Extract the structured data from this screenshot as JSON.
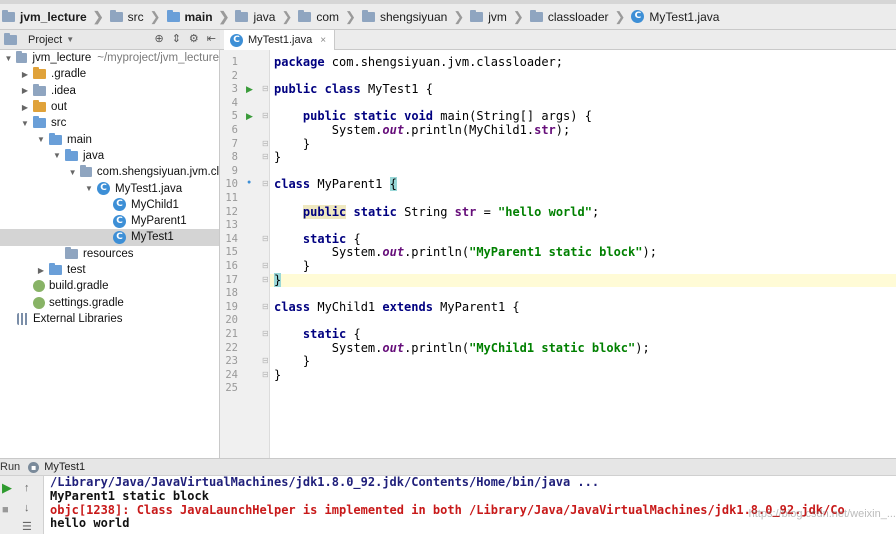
{
  "breadcrumb": [
    {
      "label": "jvm_lecture",
      "icon": "folder-icon",
      "bold": true
    },
    {
      "label": "src",
      "icon": "folder-icon",
      "bold": false
    },
    {
      "label": "main",
      "icon": "folder-icon",
      "bold": true
    },
    {
      "label": "java",
      "icon": "folder-icon",
      "bold": false
    },
    {
      "label": "com",
      "icon": "folder-icon",
      "bold": false
    },
    {
      "label": "shengsiyuan",
      "icon": "folder-icon",
      "bold": false
    },
    {
      "label": "jvm",
      "icon": "folder-icon",
      "bold": false
    },
    {
      "label": "classloader",
      "icon": "folder-icon",
      "bold": false
    },
    {
      "label": "MyTest1.java",
      "icon": "class-icon",
      "bold": false
    }
  ],
  "project": {
    "title": "Project",
    "tree": [
      {
        "label": "jvm_lecture",
        "note": "~/myproject/jvm_lecture",
        "indent": 0,
        "arrow": "down",
        "icon": "folder-icon"
      },
      {
        "label": ".gradle",
        "indent": 1,
        "arrow": "right",
        "icon": "folder-icon"
      },
      {
        "label": ".idea",
        "indent": 1,
        "arrow": "right",
        "icon": "folder-icon"
      },
      {
        "label": "out",
        "indent": 1,
        "arrow": "right",
        "icon": "folder-icon"
      },
      {
        "label": "src",
        "indent": 1,
        "arrow": "down",
        "icon": "folder-icon"
      },
      {
        "label": "main",
        "indent": 2,
        "arrow": "down",
        "icon": "folder-icon"
      },
      {
        "label": "java",
        "indent": 3,
        "arrow": "down",
        "icon": "folder-icon"
      },
      {
        "label": "com.shengsiyuan.jvm.cl",
        "indent": 4,
        "arrow": "down",
        "icon": "package-icon"
      },
      {
        "label": "MyTest1.java",
        "indent": 5,
        "arrow": "down",
        "icon": "class-icon"
      },
      {
        "label": "MyChild1",
        "indent": 6,
        "arrow": "",
        "icon": "class-icon"
      },
      {
        "label": "MyParent1",
        "indent": 6,
        "arrow": "",
        "icon": "class-icon"
      },
      {
        "label": "MyTest1",
        "indent": 6,
        "arrow": "",
        "icon": "class-icon",
        "selected": true
      },
      {
        "label": "resources",
        "indent": 3,
        "arrow": "",
        "icon": "folder-icon"
      },
      {
        "label": "test",
        "indent": 2,
        "arrow": "right",
        "icon": "folder-icon"
      },
      {
        "label": "build.gradle",
        "indent": 1,
        "arrow": "",
        "icon": "gradle-icon"
      },
      {
        "label": "settings.gradle",
        "indent": 1,
        "arrow": "",
        "icon": "gradle-icon"
      },
      {
        "label": "External Libraries",
        "indent": 0,
        "arrow": "",
        "icon": "library-icon"
      }
    ]
  },
  "editor": {
    "tab_label": "MyTest1.java",
    "lines": [
      "package com.shengsiyuan.jvm.classloader;",
      "",
      "public class MyTest1 {",
      "",
      "    public static void main(String[] args) {",
      "        System.out.println(MyChild1.str);",
      "    }",
      "}",
      "",
      "class MyParent1 {",
      "",
      "    public static String str = \"hello world\";",
      "",
      "    static {",
      "        System.out.println(\"MyParent1 static block\");",
      "    }",
      "}",
      "",
      "class MyChild1 extends MyParent1 {",
      "",
      "    static {",
      "        System.out.println(\"MyChild1 static blokc\");",
      "    }",
      "}",
      ""
    ]
  },
  "run": {
    "label": "Run",
    "config": "MyTest1",
    "console": [
      {
        "text": "/Library/Java/JavaVirtualMachines/jdk1.8.0_92.jdk/Contents/Home/bin/java ...",
        "kind": "cmd"
      },
      {
        "text": "MyParent1 static block",
        "kind": "out"
      },
      {
        "text": "objc[1238]: Class JavaLaunchHelper is implemented in both /Library/Java/JavaVirtualMachines/jdk1.8.0_92.jdk/Co",
        "kind": "err"
      },
      {
        "text": "hello world",
        "kind": "out"
      }
    ]
  },
  "watermark": "https://blog.csdn.net/weixin_..."
}
